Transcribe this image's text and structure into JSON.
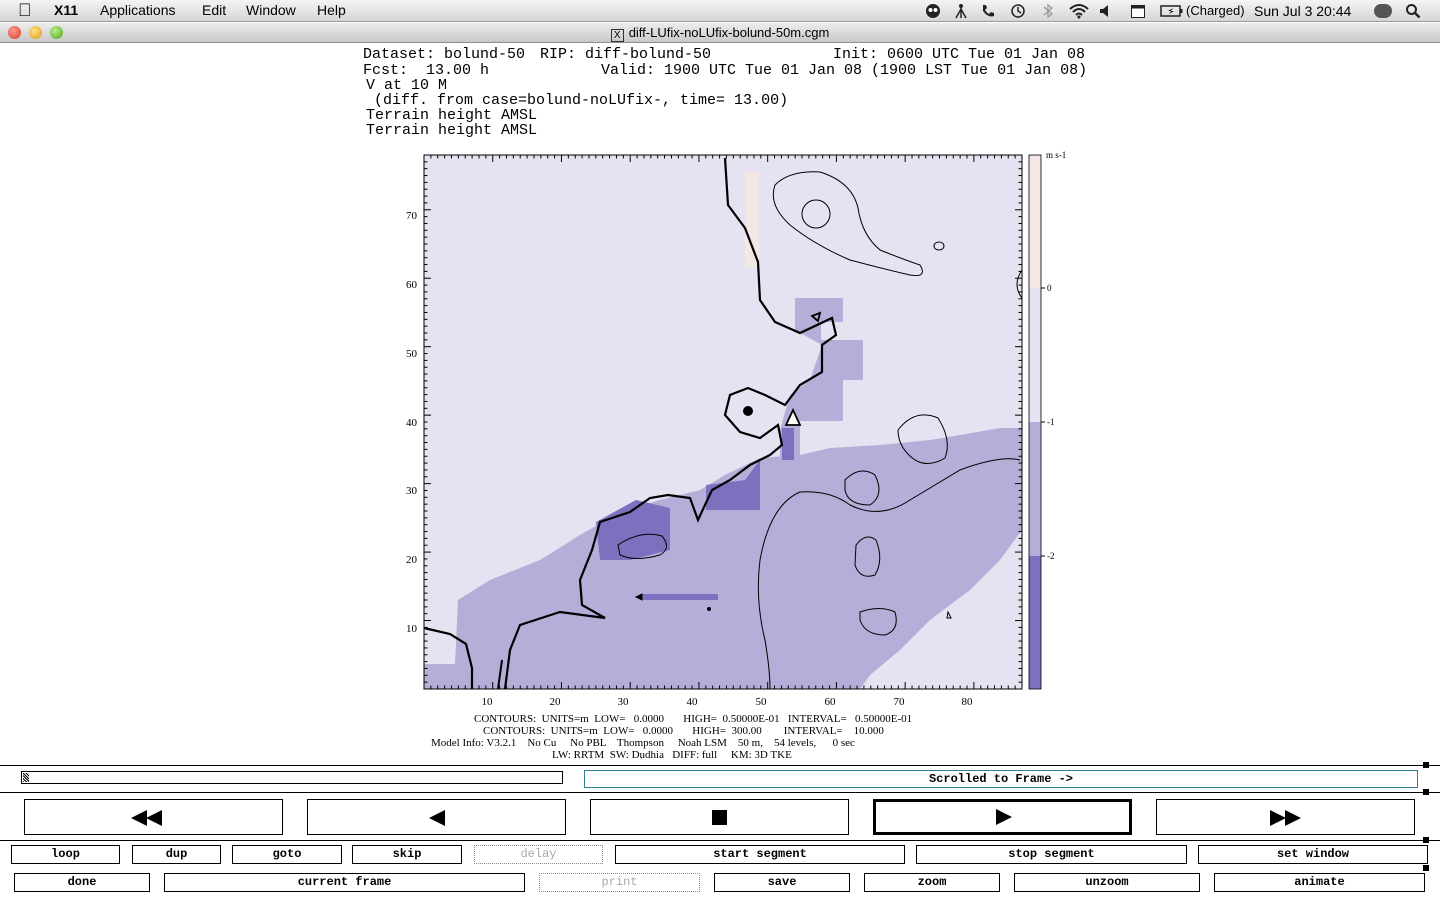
{
  "menubar": {
    "app": "X11",
    "items": [
      "Applications",
      "Edit",
      "Window",
      "Help"
    ],
    "battery": "(Charged)",
    "datetime": "Sun Jul 3  20:44"
  },
  "window": {
    "title": "diff-LUfix-noLUfix-bolund-50m.cgm"
  },
  "plot": {
    "header": {
      "dataset": "Dataset: bolund-50",
      "rip": "RIP: diff-bolund-50",
      "init": "Init: 0600 UTC Tue 01 Jan 08",
      "fcst_label": "Fcst:",
      "fcst_value": "13.00 h",
      "valid": "Valid: 1900 UTC Tue 01 Jan 08 (1900 LST Tue 01 Jan 08)",
      "line3": "V at 10 M",
      "line4": "(diff. from case=bolund-noLUfix-, time= 13.00)",
      "line5": "Terrain height AMSL",
      "line6": "Terrain height AMSL"
    },
    "footer": {
      "line1": "CONTOURS:  UNITS=m  LOW=   0.0000       HIGH=  0.50000E-01   INTERVAL=   0.50000E-01",
      "line2": "CONTOURS:  UNITS=m  LOW=   0.0000       HIGH=  300.00        INTERVAL=    10.000",
      "line3": "Model Info: V3.2.1    No Cu     No PBL    Thompson     Noah LSM    50 m,    54 levels,      0 sec",
      "line4": "LW: RRTM  SW: Dudhia   DIFF: full     KM: 3D TKE"
    },
    "colors": {
      "c0": "#e5e3f1",
      "c1": "#b5aed8",
      "c2": "#7e70bf",
      "pos": "#f4e7e6"
    }
  },
  "chart_data": {
    "type": "heatmap",
    "xticks": [
      "10",
      "20",
      "30",
      "40",
      "50",
      "60",
      "70",
      "80"
    ],
    "yticks": [
      "10",
      "20",
      "30",
      "40",
      "50",
      "60",
      "70"
    ],
    "colorbar": {
      "unit": "m s-1",
      "ticks": [
        "0",
        "-1",
        "-2"
      ]
    }
  },
  "controls": {
    "status": "Scrolled to Frame ->",
    "row1": [
      "loop",
      "dup",
      "goto",
      "skip",
      "delay",
      "start segment",
      "stop segment",
      "set window"
    ],
    "row2": [
      "done",
      "current frame",
      "print",
      "save",
      "zoom",
      "unzoom",
      "animate"
    ]
  }
}
